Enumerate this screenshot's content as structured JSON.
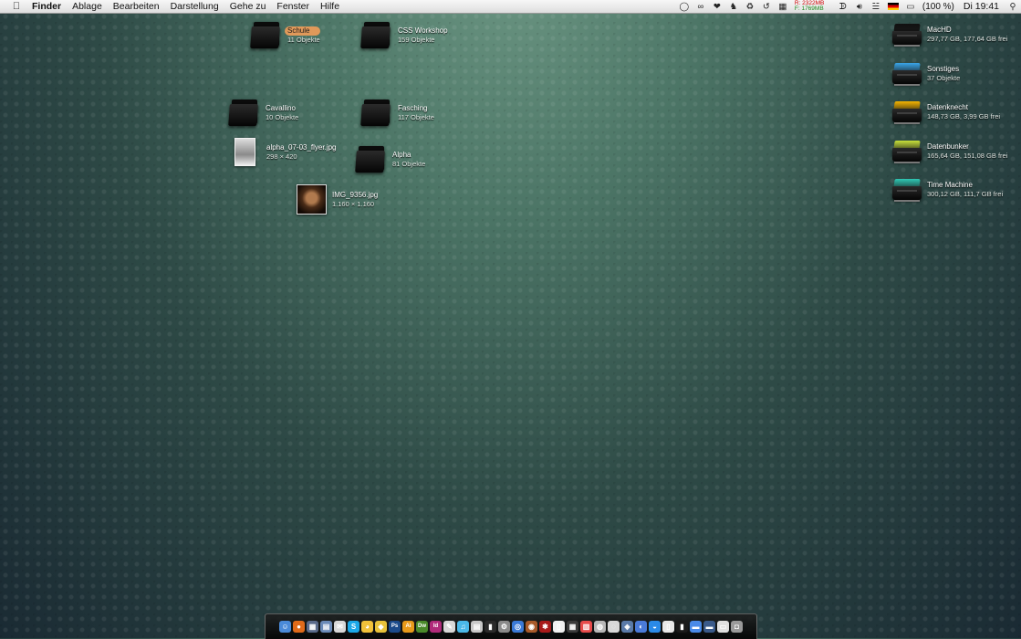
{
  "menubar": {
    "app": "Finder",
    "menus": [
      "Ablage",
      "Bearbeiten",
      "Darstellung",
      "Gehe zu",
      "Fenster",
      "Hilfe"
    ],
    "memory_r": "R: 2322MB",
    "memory_f": "F: 1769MB",
    "battery": "(100 %)",
    "clock": "Di 19:41"
  },
  "desktop": {
    "items": [
      {
        "name": "Schule",
        "sub": "11 Objekte",
        "icon": "folder-icon"
      },
      {
        "name": "CSS Workshop",
        "sub": "159 Objekte",
        "icon": "folder-icon"
      },
      {
        "name": "Cavallino",
        "sub": "10 Objekte",
        "icon": "folder-icon"
      },
      {
        "name": "Fasching",
        "sub": "117 Objekte",
        "icon": "folder-icon"
      },
      {
        "name": "alpha_07-03_flyer.jpg",
        "sub": "298 × 420",
        "icon": "image-thumbnail-icon"
      },
      {
        "name": "Alpha",
        "sub": "81 Objekte",
        "icon": "folder-icon"
      },
      {
        "name": "IMG_9356.jpg",
        "sub": "1.160 × 1.160",
        "icon": "photo-thumbnail-icon"
      }
    ],
    "volumes": [
      {
        "name": "MacHD",
        "sub": "297,77 GB, 177,64 GB frei",
        "color": "#111111"
      },
      {
        "name": "Sonstiges",
        "sub": "37 Objekte",
        "color": "#3aa6e8"
      },
      {
        "name": "Datenknecht",
        "sub": "148,73 GB, 3,99 GB frei",
        "color": "#f5b400"
      },
      {
        "name": "Datenbunker",
        "sub": "165,64 GB, 151,08 GB frei",
        "color": "#c8e03a"
      },
      {
        "name": "Time Machine",
        "sub": "300,12 GB, 111,7 GB frei",
        "color": "#2fc8b4"
      }
    ]
  },
  "dock": {
    "icons": [
      {
        "name": "finder-icon",
        "color": "#4a8ad8",
        "glyph": "☺"
      },
      {
        "name": "firefox-icon",
        "color": "#e06a1a",
        "glyph": "●"
      },
      {
        "name": "mission-control-icon",
        "color": "#5a6a8a",
        "glyph": "▦"
      },
      {
        "name": "preview-icon",
        "color": "#6a8ab8",
        "glyph": "▤"
      },
      {
        "name": "mail-icon",
        "color": "#d8d8d8",
        "glyph": "✉"
      },
      {
        "name": "skype-icon",
        "color": "#1aa8e8",
        "glyph": "S"
      },
      {
        "name": "adium-icon",
        "color": "#f2c23a",
        "glyph": "◕"
      },
      {
        "name": "cyberduck-icon",
        "color": "#e8c23a",
        "glyph": "◆"
      },
      {
        "name": "photoshop-icon",
        "color": "#1a4a8a",
        "glyph": "Ps"
      },
      {
        "name": "illustrator-icon",
        "color": "#e89a1a",
        "glyph": "Ai"
      },
      {
        "name": "dreamweaver-icon",
        "color": "#4a8a2a",
        "glyph": "Dw"
      },
      {
        "name": "indesign-icon",
        "color": "#b02a7a",
        "glyph": "Id"
      },
      {
        "name": "acrobat-icon",
        "color": "#d8d8d8",
        "glyph": "✎"
      },
      {
        "name": "itunes-icon",
        "color": "#4ab8e8",
        "glyph": "♫"
      },
      {
        "name": "textedit-icon",
        "color": "#c8c8c8",
        "glyph": "▤"
      },
      {
        "name": "terminal-icon",
        "color": "#2a2a2a",
        "glyph": "▮"
      },
      {
        "name": "system-preferences-icon",
        "color": "#8a8a8a",
        "glyph": "⚙"
      },
      {
        "name": "safari-icon",
        "color": "#3a7ad8",
        "glyph": "◎"
      },
      {
        "name": "photo-booth-icon",
        "color": "#a85a2a",
        "glyph": "◉"
      },
      {
        "name": "spider-app-icon",
        "color": "#a81a1a",
        "glyph": "✱"
      },
      {
        "name": "document-icon",
        "color": "#f0f0f0",
        "glyph": "▯"
      },
      {
        "name": "calculator-icon",
        "color": "#3a3a3a",
        "glyph": "▦"
      },
      {
        "name": "ical-icon",
        "color": "#e84a4a",
        "glyph": "▥"
      },
      {
        "name": "disk-utility-icon",
        "color": "#b8b8b8",
        "glyph": "◍"
      },
      {
        "name": "network-icon",
        "color": "#d8d8d8",
        "glyph": "◌"
      },
      {
        "name": "xcode-icon",
        "color": "#5a7aa8",
        "glyph": "◈"
      },
      {
        "name": "dashboard-icon",
        "color": "#4a7ad8",
        "glyph": "◐"
      },
      {
        "name": "activity-monitor-icon",
        "color": "#2a8ae8",
        "glyph": "◒"
      },
      {
        "name": "notes-icon",
        "color": "#e8e8e8",
        "glyph": "▯"
      },
      {
        "name": "stacks-icon",
        "color": "#1a1a1a",
        "glyph": "▮"
      },
      {
        "name": "folder-stack-icon",
        "color": "#4a8ae8",
        "glyph": "▬"
      },
      {
        "name": "applications-folder-icon",
        "color": "#3a5a8a",
        "glyph": "▬"
      },
      {
        "name": "downloads-folder-icon",
        "color": "#e0e0e0",
        "glyph": "▭"
      },
      {
        "name": "trash-icon",
        "color": "#9a9a9a",
        "glyph": "◘"
      }
    ]
  }
}
